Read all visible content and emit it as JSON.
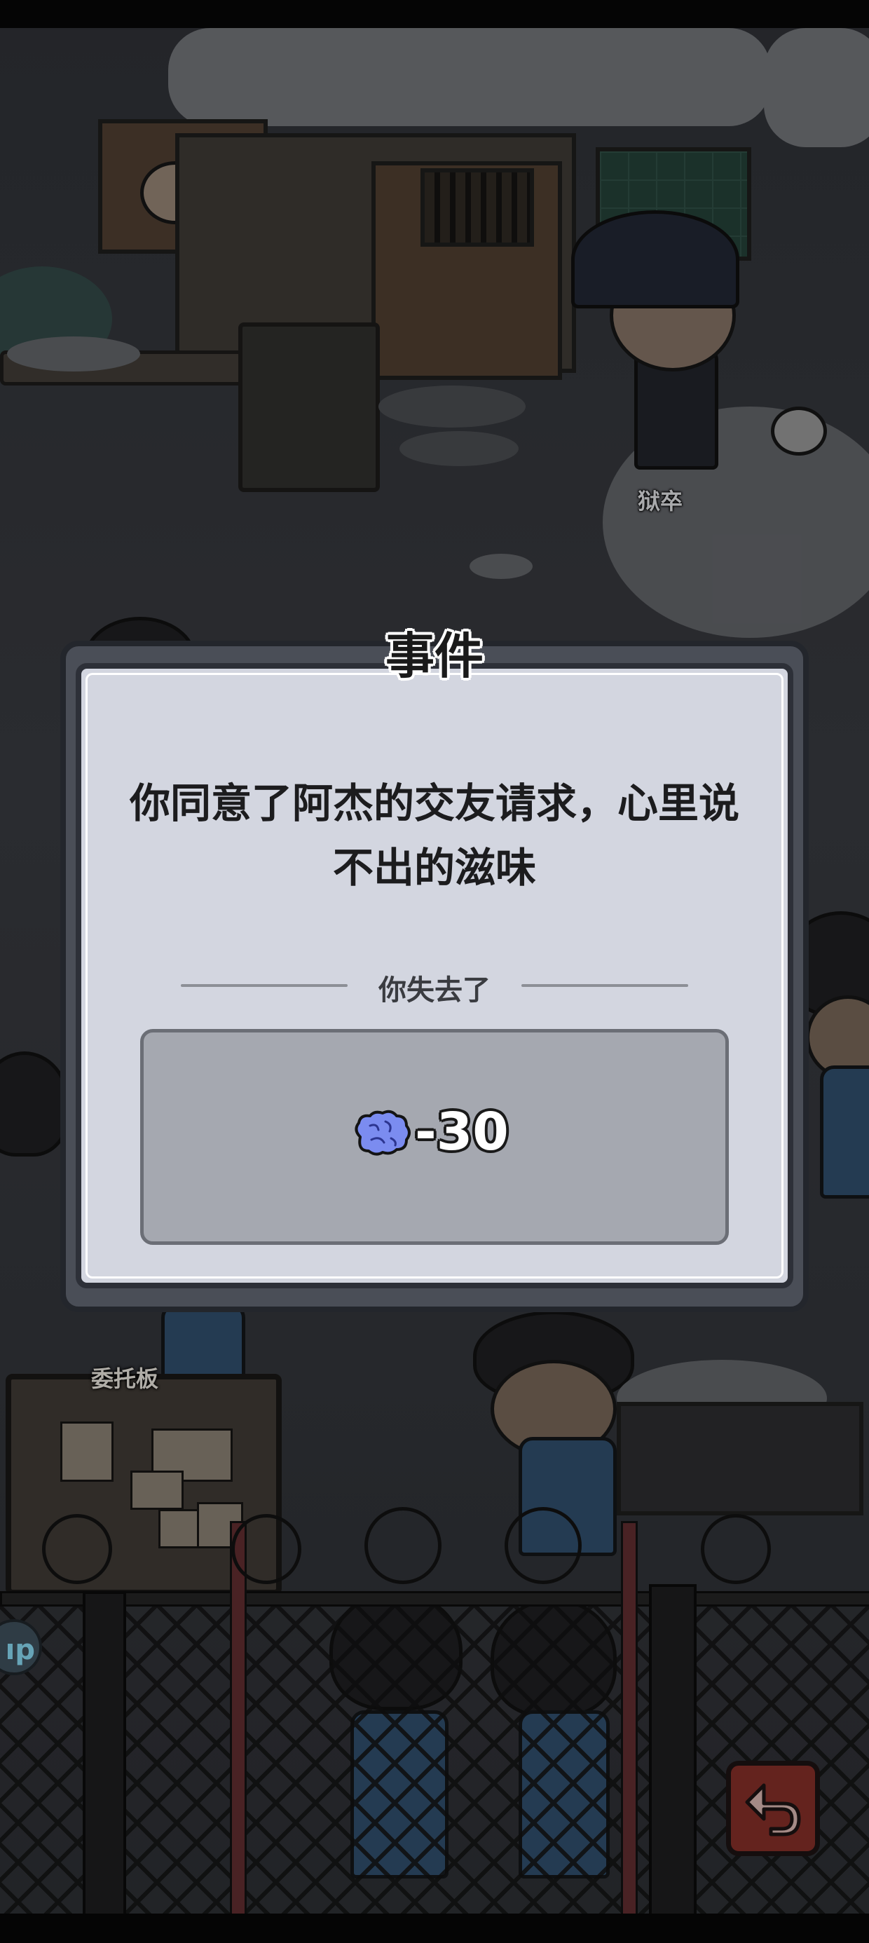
{
  "event_dialog": {
    "title": "事件",
    "message": "你同意了阿杰的交友请求，心里说不出的滋味",
    "lost_label": "你失去了",
    "resource_icon": "brain-icon",
    "resource_change": "-30"
  },
  "scene": {
    "guard_name": "狱卒",
    "board_title": "委托板",
    "help_button_text": "ıp",
    "back_button_icon": "return-arrow-icon"
  },
  "colors": {
    "dialog_bg": "#d3d6e0",
    "reward_box_bg": "#a5a8b0",
    "brain_icon": "#7b8cf0",
    "back_button": "#7a2b25"
  }
}
